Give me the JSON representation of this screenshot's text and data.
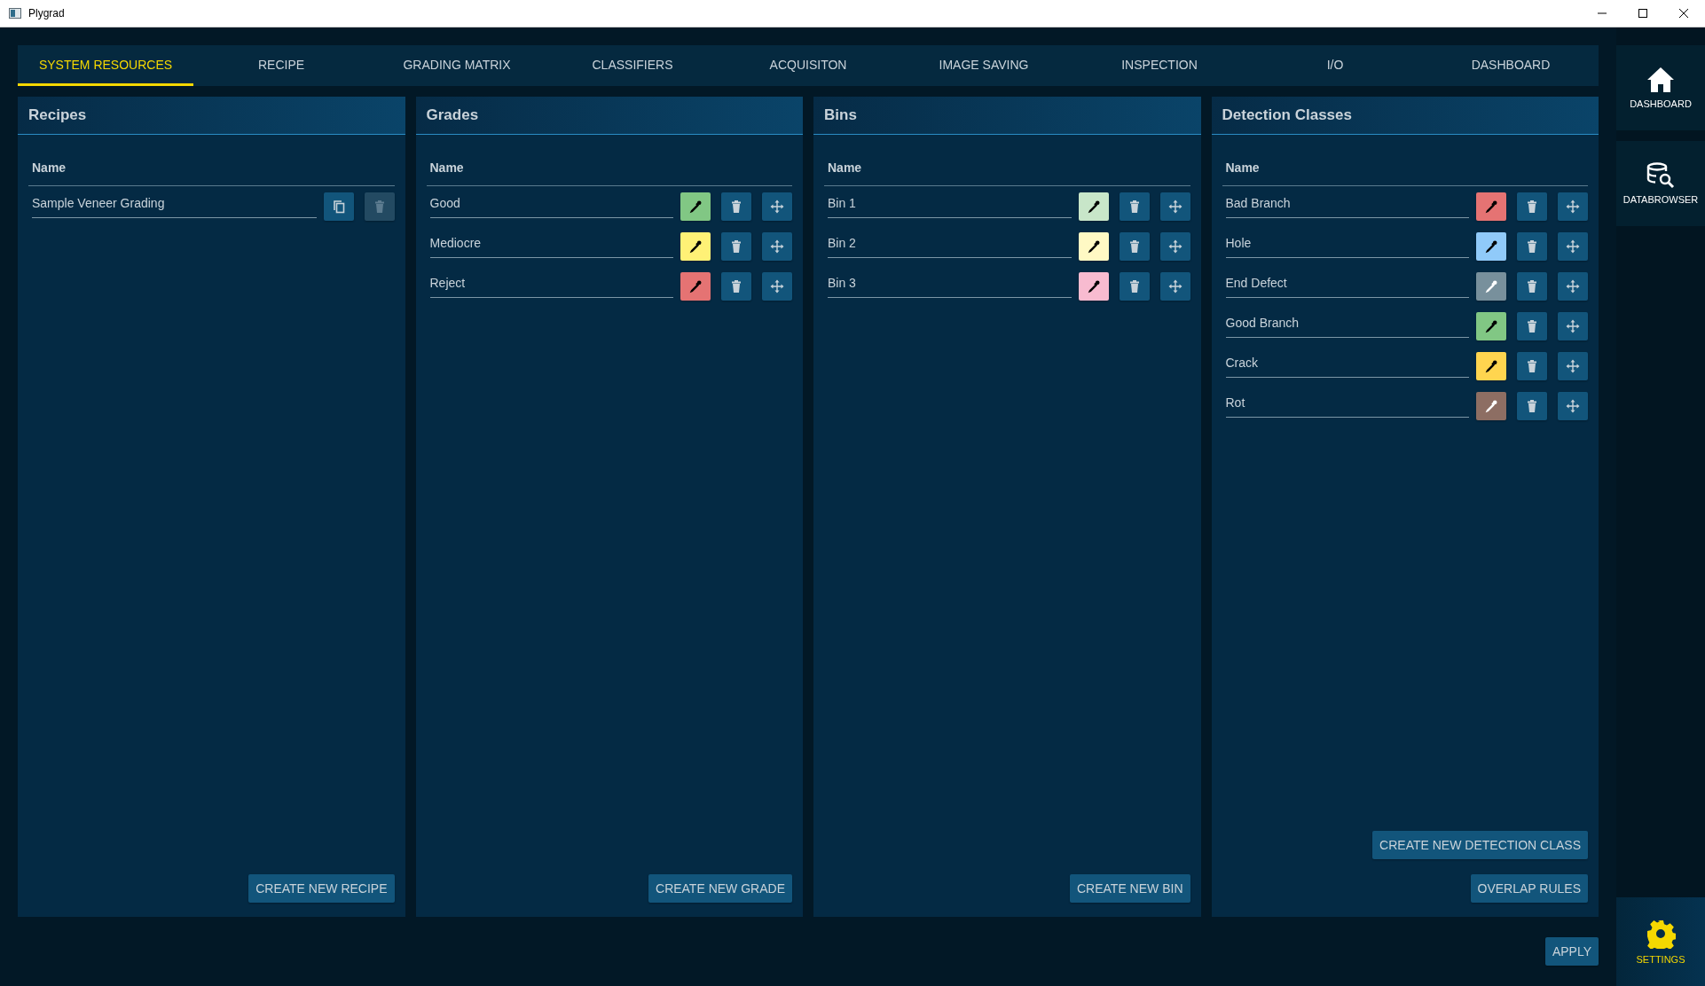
{
  "window": {
    "title": "Plygrad"
  },
  "tabs": [
    {
      "label": "SYSTEM RESOURCES",
      "selected": true
    },
    {
      "label": "RECIPE",
      "selected": false
    },
    {
      "label": "GRADING MATRIX",
      "selected": false
    },
    {
      "label": "CLASSIFIERS",
      "selected": false
    },
    {
      "label": "ACQUISITON",
      "selected": false
    },
    {
      "label": "IMAGE SAVING",
      "selected": false
    },
    {
      "label": "INSPECTION",
      "selected": false
    },
    {
      "label": "I/O",
      "selected": false
    },
    {
      "label": "DASHBOARD",
      "selected": false
    }
  ],
  "panels": [
    {
      "title": "Recipes",
      "kind": "recipe",
      "column": "Name",
      "rows": [
        {
          "name": "Sample Veneer Grading",
          "delete_disabled": true
        }
      ],
      "buttons": [
        "CREATE NEW RECIPE"
      ]
    },
    {
      "title": "Grades",
      "kind": "colored",
      "column": "Name",
      "rows": [
        {
          "name": "Good",
          "color": "#81c784"
        },
        {
          "name": "Mediocre",
          "color": "#fff176"
        },
        {
          "name": "Reject",
          "color": "#e57373"
        }
      ],
      "buttons": [
        "CREATE NEW GRADE"
      ]
    },
    {
      "title": "Bins",
      "kind": "colored",
      "column": "Name",
      "rows": [
        {
          "name": "Bin 1",
          "color": "#c8e6c9"
        },
        {
          "name": "Bin 2",
          "color": "#fff9c4"
        },
        {
          "name": "Bin 3",
          "color": "#f8bbd0"
        }
      ],
      "buttons": [
        "CREATE NEW BIN"
      ]
    },
    {
      "title": "Detection Classes",
      "kind": "colored",
      "column": "Name",
      "rows": [
        {
          "name": "Bad Branch",
          "color": "#e57373"
        },
        {
          "name": "Hole",
          "color": "#90caf9"
        },
        {
          "name": "End Defect",
          "color": "#78909c"
        },
        {
          "name": "Good Branch",
          "color": "#81c784"
        },
        {
          "name": "Crack",
          "color": "#ffd54f"
        },
        {
          "name": "Rot",
          "color": "#8d6e63"
        }
      ],
      "buttons": [
        "CREATE NEW DETECTION CLASS",
        "OVERLAP RULES"
      ]
    }
  ],
  "apply_button": "APPLY",
  "sidebar": {
    "top_items": [
      {
        "label": "DASHBOARD",
        "kind": "home",
        "selected": false
      },
      {
        "label": "DATABROWSER",
        "kind": "database-search",
        "selected": false
      }
    ],
    "bottom_items": [
      {
        "label": "SETTINGS",
        "kind": "gear",
        "selected": true
      }
    ]
  }
}
